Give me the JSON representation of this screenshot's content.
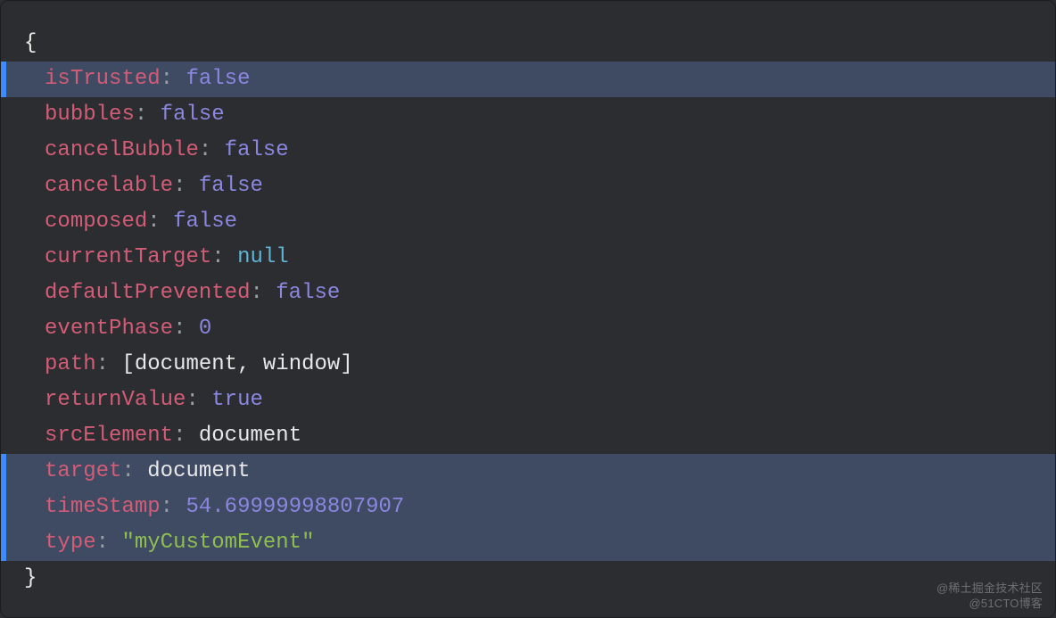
{
  "brace_open": "{",
  "brace_close": "}",
  "colon": ": ",
  "path_open": "[",
  "path_close": "]",
  "path_sep": ", ",
  "lines": [
    {
      "key": "isTrusted",
      "val": "false",
      "cls": "tok-bool",
      "hl": true
    },
    {
      "key": "bubbles",
      "val": "false",
      "cls": "tok-bool",
      "hl": false
    },
    {
      "key": "cancelBubble",
      "val": "false",
      "cls": "tok-bool",
      "hl": false
    },
    {
      "key": "cancelable",
      "val": "false",
      "cls": "tok-bool",
      "hl": false
    },
    {
      "key": "composed",
      "val": "false",
      "cls": "tok-bool",
      "hl": false
    },
    {
      "key": "currentTarget",
      "val": "null",
      "cls": "tok-null",
      "hl": false
    },
    {
      "key": "defaultPrevented",
      "val": "false",
      "cls": "tok-bool",
      "hl": false
    },
    {
      "key": "eventPhase",
      "val": "0",
      "cls": "tok-num",
      "hl": false
    },
    {
      "key": "path",
      "val": [
        "document",
        "window"
      ],
      "cls": "tok-white",
      "hl": false,
      "array": true
    },
    {
      "key": "returnValue",
      "val": "true",
      "cls": "tok-bool",
      "hl": false
    },
    {
      "key": "srcElement",
      "val": "document",
      "cls": "tok-white",
      "hl": false
    },
    {
      "key": "target",
      "val": "document",
      "cls": "tok-white",
      "hl": true
    },
    {
      "key": "timeStamp",
      "val": "54.69999998807907",
      "cls": "tok-num",
      "hl": true
    },
    {
      "key": "type",
      "val": "\"myCustomEvent\"",
      "cls": "tok-str",
      "hl": true
    }
  ],
  "watermark": {
    "line1": "@稀土掘金技术社区",
    "line2": "@51CTO博客"
  }
}
